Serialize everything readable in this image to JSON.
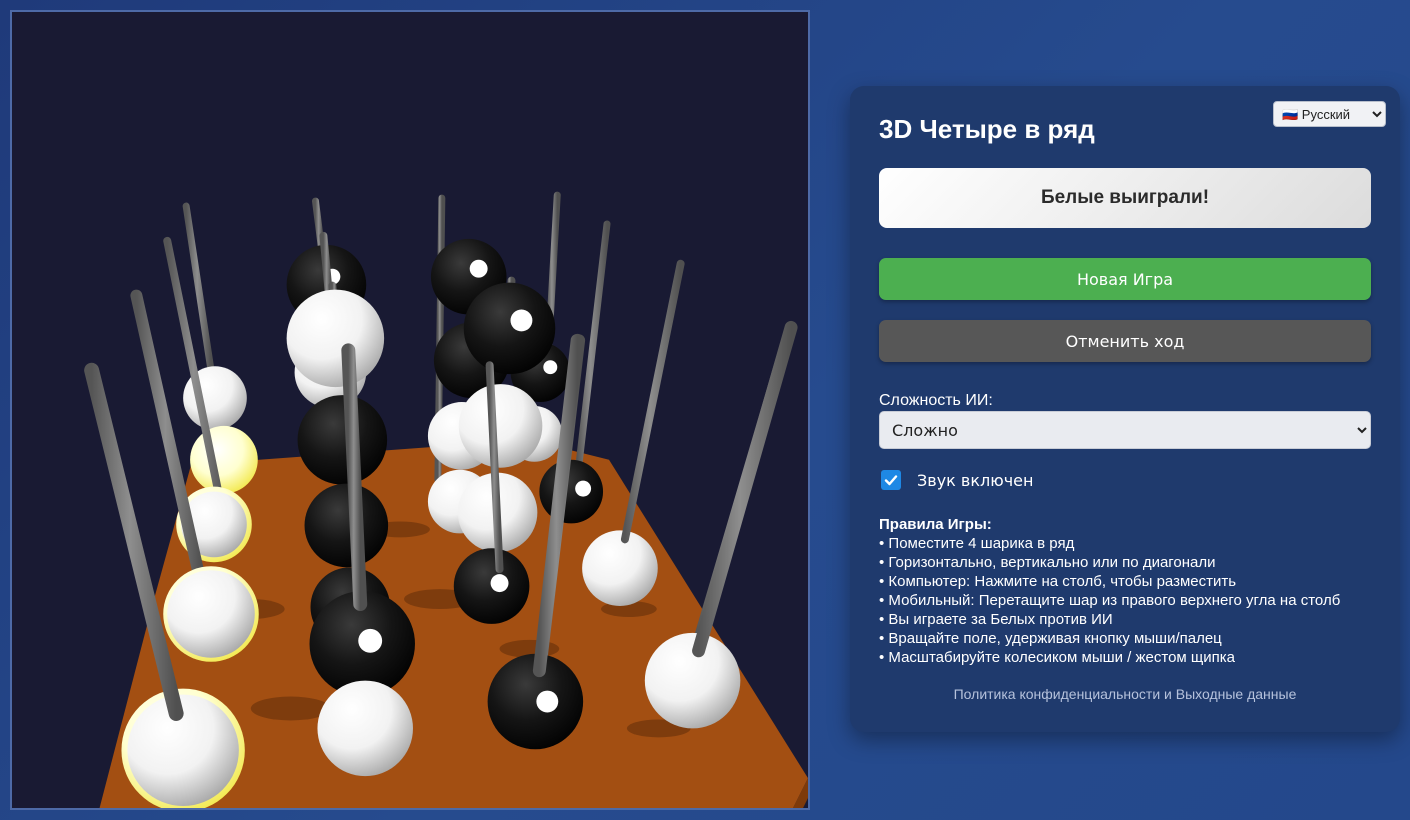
{
  "language": {
    "flag": "🇷🇺",
    "selected": "Русский"
  },
  "game": {
    "title": "3D Четыре в ряд",
    "status": "Белые выиграли!",
    "new_game_label": "Новая Игра",
    "undo_label": "Отменить ход"
  },
  "difficulty": {
    "label": "Сложность ИИ:",
    "selected": "Сложно"
  },
  "sound": {
    "label": "Звук включен",
    "enabled": true
  },
  "rules": {
    "title": "Правила Игры:",
    "items": [
      "• Поместите 4 шарика в ряд",
      "• Горизонтально, вертикально или по диагонали",
      "• Компьютер: Нажмите на столб, чтобы разместить",
      "• Мобильный: Перетащите шар из правого верхнего угла на столб",
      "• Вы играете за Белых против ИИ",
      "• Вращайте поле, удерживая кнопку мыши/палец",
      "• Масштабируйте колесиком мыши / жестом щипка"
    ]
  },
  "footer": {
    "privacy_link": "Политика конфиденциальности и Выходные данные"
  },
  "colors": {
    "background": "#24488b",
    "scene_background": "#191a33",
    "board": "#a34f12",
    "pole": "#7a7a7a",
    "white_ball": "#f2f2f2",
    "black_ball": "#111111",
    "winning_highlight": "#ffff8a",
    "new_game_button": "#4caf50",
    "undo_button": "#575757"
  }
}
